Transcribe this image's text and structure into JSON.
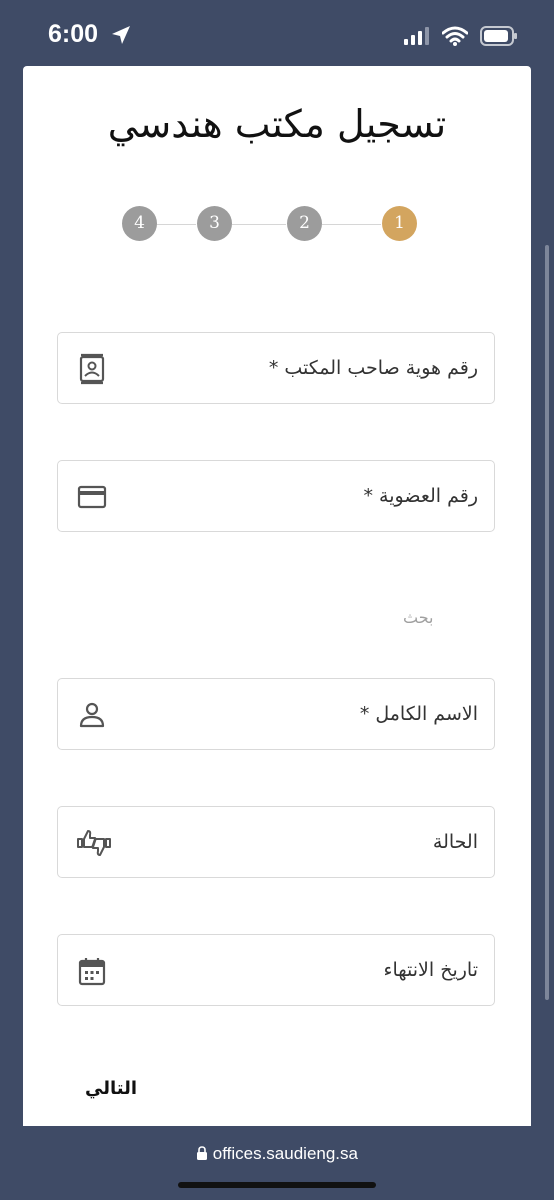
{
  "status_bar": {
    "time": "6:00",
    "icons": [
      "location-arrow-icon",
      "signal-icon",
      "wifi-icon",
      "battery-icon"
    ]
  },
  "page": {
    "title": "تسجيل مكتب هندسي"
  },
  "stepper": {
    "steps": [
      "1",
      "2",
      "3",
      "4"
    ],
    "active_step": 1,
    "active_color": "#d3a55f",
    "inactive_color": "#9c9c9c"
  },
  "form": {
    "owner_id_label": "رقم هوية صاحب المكتب *",
    "membership_label": "رقم العضوية *",
    "search_label": "بحث",
    "full_name_label": "الاسم الكامل *",
    "status_label": "الحالة",
    "expiry_label": "تاريخ الانتهاء",
    "icons": {
      "owner_id": "contact-card-icon",
      "membership": "credit-card-icon",
      "full_name": "person-icon",
      "status": "thumbs-up-down-icon",
      "expiry": "calendar-icon"
    }
  },
  "actions": {
    "next_label": "التالي"
  },
  "browser": {
    "url": "offices.saudieng.sa"
  },
  "colors": {
    "background": "#3f4b66",
    "accent": "#d3a55f"
  }
}
